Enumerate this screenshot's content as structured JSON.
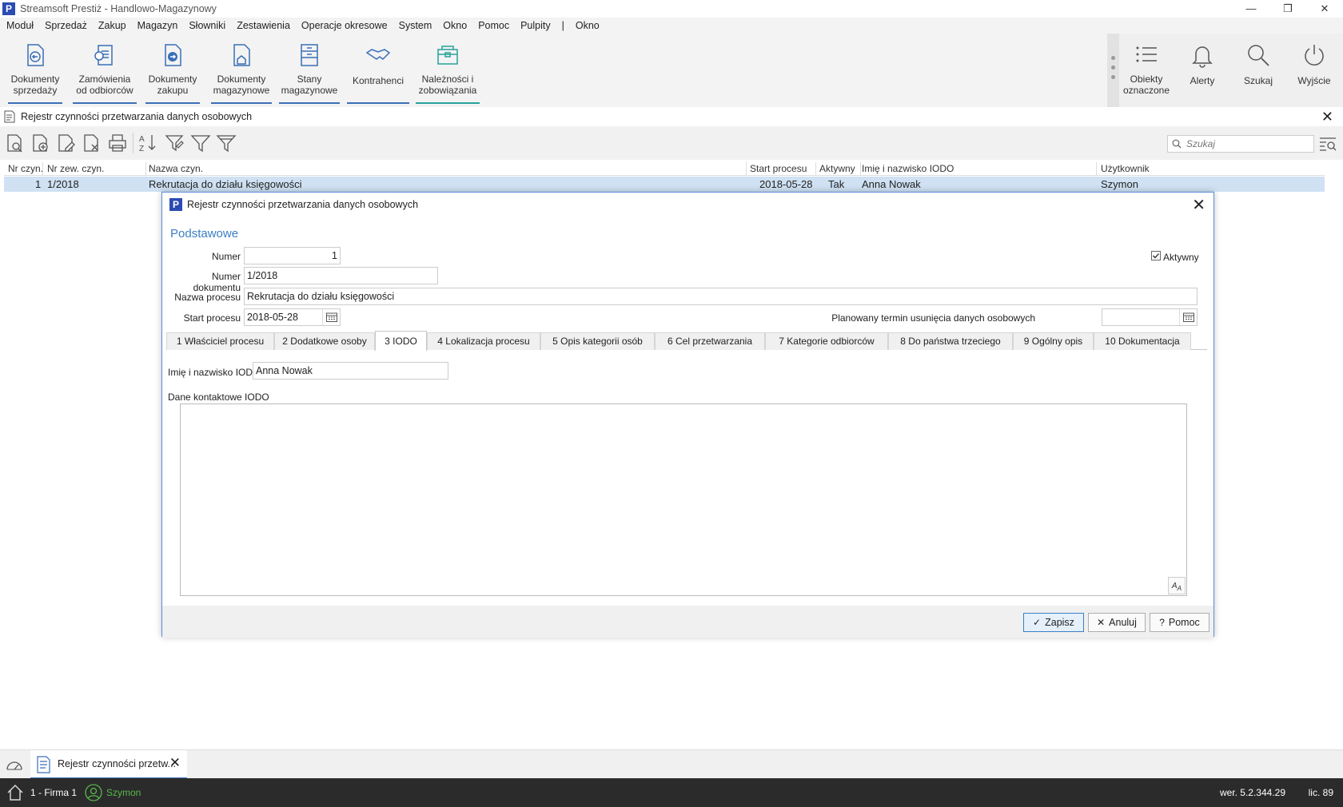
{
  "window": {
    "title": "Streamsoft Prestiż - Handlowo-Magazynowy",
    "logo_letter": "P",
    "minimize": "—",
    "restore": "❐",
    "close": "✕"
  },
  "menu": [
    "Moduł",
    "Sprzedaż",
    "Zakup",
    "Magazyn",
    "Słowniki",
    "Zestawienia",
    "Operacje okresowe",
    "System",
    "Okno",
    "Pomoc",
    "Pulpity",
    "|",
    "Okno"
  ],
  "ribbon": {
    "items": [
      {
        "line1": "Dokumenty",
        "line2": "sprzedaży"
      },
      {
        "line1": "Zamówienia",
        "line2": "od odbiorców"
      },
      {
        "line1": "Dokumenty",
        "line2": "zakupu"
      },
      {
        "line1": "Dokumenty",
        "line2": "magazynowe"
      },
      {
        "line1": "Stany",
        "line2": "magazynowe"
      },
      {
        "line1": "Kontrahenci",
        "line2": ""
      },
      {
        "line1": "Należności i",
        "line2": "zobowiązania"
      }
    ],
    "right": [
      {
        "line1": "Obiekty",
        "line2": "oznaczone"
      },
      {
        "line1": "Alerty",
        "line2": ""
      },
      {
        "line1": "Szukaj",
        "line2": ""
      },
      {
        "line1": "Wyjście",
        "line2": ""
      }
    ]
  },
  "doc_tab": {
    "title": "Rejestr czynności przetwarzania danych osobowych",
    "close": "✕"
  },
  "search": {
    "placeholder": "Szukaj"
  },
  "grid": {
    "columns": [
      "Nr czyn.",
      "Nr zew. czyn.",
      "Nazwa czyn.",
      "Start procesu",
      "Aktywny",
      "Imię i nazwisko IODO",
      "Użytkownik"
    ],
    "rows": [
      [
        "1",
        "1/2018",
        "Rekrutacja do działu księgowości",
        "2018-05-28",
        "Tak",
        "Anna Nowak",
        "Szymon"
      ]
    ]
  },
  "dialog": {
    "title": "Rejestr czynności przetwarzania danych osobowych",
    "close": "✕",
    "section": "Podstawowe",
    "fields": {
      "numer_label": "Numer",
      "numer_value": "1",
      "numer_dok_label": "Numer dokumentu",
      "numer_dok_value": "1/2018",
      "nazwa_label": "Nazwa procesu",
      "nazwa_value": "Rekrutacja do działu księgowości",
      "start_label": "Start procesu",
      "start_value": "2018-05-28",
      "planowany_label": "Planowany termin usunięcia danych osobowych",
      "planowany_value": "",
      "aktywny_label": "Aktywny",
      "aktywny_checked": true
    },
    "tabs": [
      "1 Właściciel procesu",
      "2 Dodatkowe osoby",
      "3 IODO",
      "4 Lokalizacja procesu",
      "5 Opis kategorii osób",
      "6 Cel przetwarzania",
      "7 Kategorie odbiorców",
      "8 Do państwa trzeciego",
      "9 Ogólny opis",
      "10 Dokumentacja"
    ],
    "active_tab": 2,
    "iodo": {
      "name_label": "Imię i nazwisko IODO",
      "name_value": "Anna Nowak",
      "contact_label": "Dane kontaktowe IODO",
      "contact_value": ""
    },
    "buttons": {
      "save": "Zapisz",
      "cancel": "Anuluj",
      "help": "Pomoc"
    }
  },
  "taskbar": {
    "tab": "Rejestr czynności przetw...",
    "close": "✕"
  },
  "status": {
    "firm": "1 - Firma 1",
    "user": "Szymon",
    "version": "wer. 5.2.344.29",
    "license": "lic. 89"
  },
  "colors": {
    "accent": "#3a6fb6",
    "teal": "#27a19a",
    "selection": "#cfe1f3",
    "status_bg": "#2b2b2b",
    "user_green": "#58b84b"
  }
}
